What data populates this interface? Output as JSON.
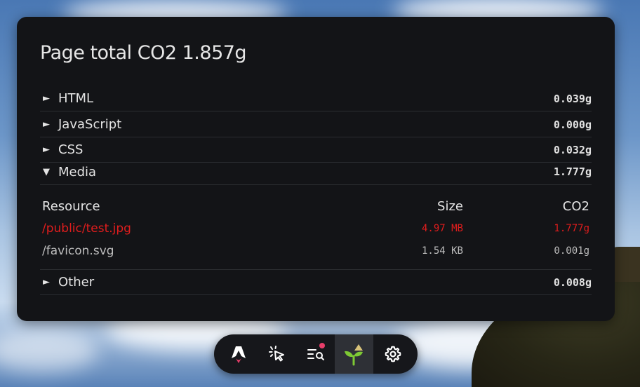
{
  "panel": {
    "title": "Page total CO2 1.857g",
    "sections": [
      {
        "label": "HTML",
        "value": "0.039g",
        "expanded": false
      },
      {
        "label": "JavaScript",
        "value": "0.000g",
        "expanded": false
      },
      {
        "label": "CSS",
        "value": "0.032g",
        "expanded": false
      },
      {
        "label": "Media",
        "value": "1.777g",
        "expanded": true
      },
      {
        "label": "Other",
        "value": "0.008g",
        "expanded": false
      }
    ],
    "arrows": {
      "collapsed": "►",
      "expanded": "▼"
    },
    "media_table": {
      "headers": {
        "resource": "Resource",
        "size": "Size",
        "co2": "CO2"
      },
      "rows": [
        {
          "resource": "/public/test.jpg",
          "size": "4.97 MB",
          "co2": "1.777g",
          "highlight": true
        },
        {
          "resource": "/favicon.svg",
          "size": "1.54 KB",
          "co2": "0.001g",
          "highlight": false
        }
      ]
    }
  },
  "toolbar": {
    "items": [
      {
        "icon": "astro-logo-icon",
        "active": false
      },
      {
        "icon": "cursor-click-icon",
        "active": false
      },
      {
        "icon": "audit-list-icon",
        "active": false,
        "notification": true
      },
      {
        "icon": "sprout-icon",
        "active": true
      },
      {
        "icon": "settings-gear-icon",
        "active": false
      }
    ]
  },
  "colors": {
    "panel_bg": "#131417",
    "highlight_red": "#e11d1d",
    "notification_dot": "#e83e6a",
    "sprout_green": "#7ec934",
    "sprout_triangle": "#d8c27a"
  }
}
